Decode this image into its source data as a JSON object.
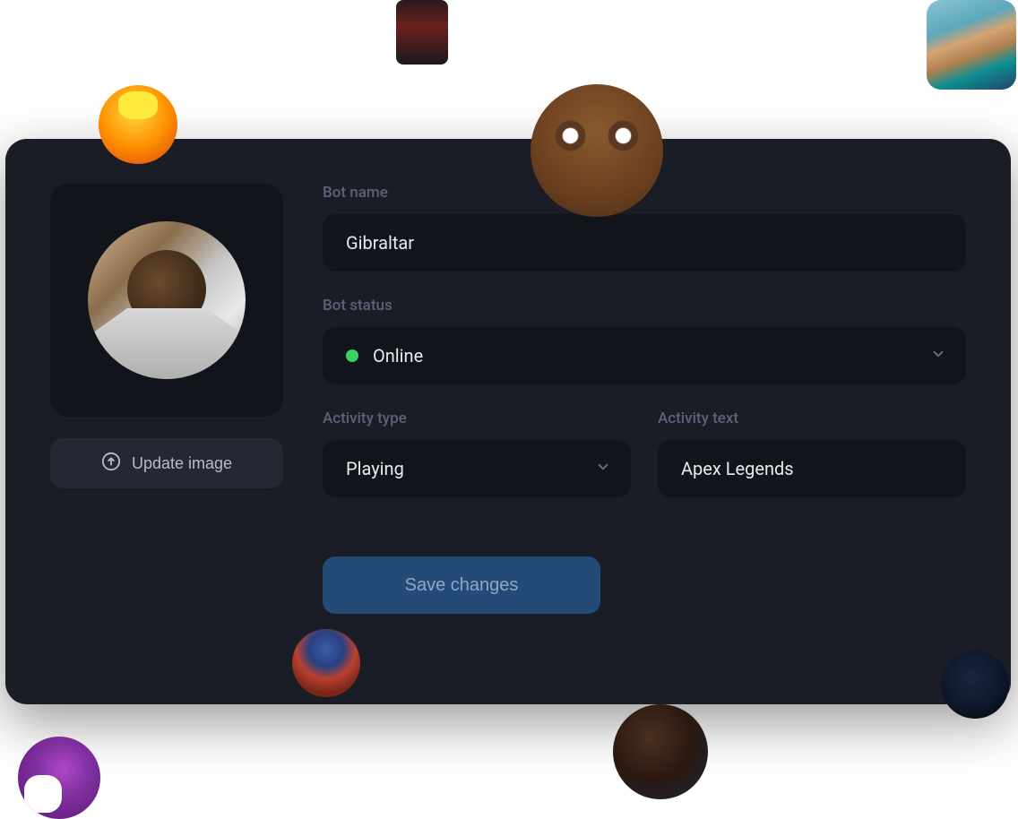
{
  "form": {
    "bot_name": {
      "label": "Bot name",
      "value": "Gibraltar"
    },
    "bot_status": {
      "label": "Bot status",
      "value": "Online",
      "status_color": "#3ecf63"
    },
    "activity_type": {
      "label": "Activity type",
      "value": "Playing"
    },
    "activity_text": {
      "label": "Activity text",
      "value": "Apex Legends"
    }
  },
  "buttons": {
    "update_image": "Update image",
    "save_changes": "Save changes"
  }
}
